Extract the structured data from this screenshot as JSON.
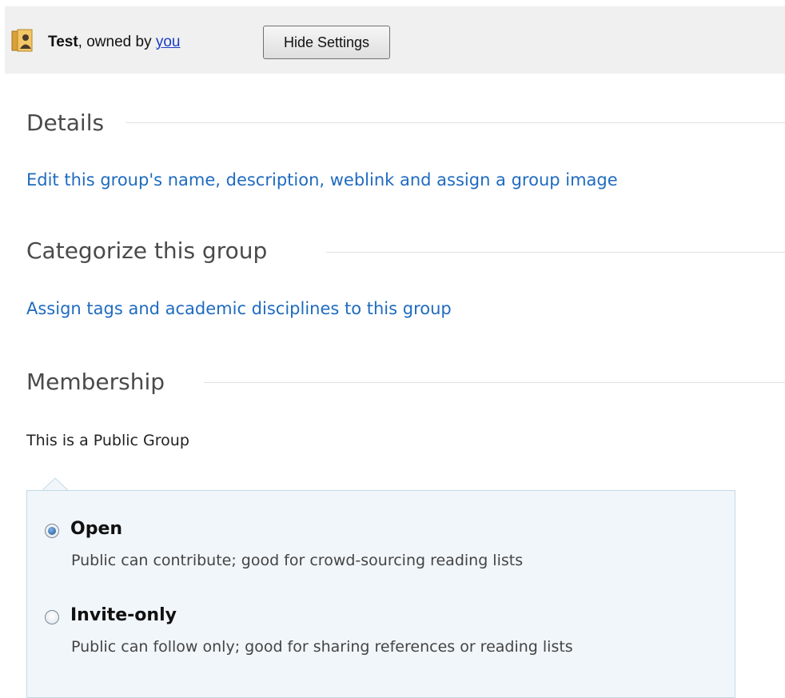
{
  "header": {
    "group_name": "Test",
    "owned_by_text": ", owned by ",
    "owner_link": "you",
    "hide_settings_label": "Hide Settings"
  },
  "sections": {
    "details": {
      "heading": "Details",
      "link": "Edit this group's name, description, weblink and assign a group image"
    },
    "categorize": {
      "heading": "Categorize this group",
      "link": "Assign tags and academic disciplines to this group"
    },
    "membership": {
      "heading": "Membership",
      "status": "This is a Public Group",
      "options": [
        {
          "label": "Open",
          "description": "Public can contribute; good for crowd-sourcing reading lists",
          "selected": true
        },
        {
          "label": "Invite-only",
          "description": "Public can follow only; good for sharing references or reading lists",
          "selected": false
        }
      ]
    }
  },
  "colors": {
    "link": "#1f6bbf",
    "header_bg": "#f0f0f0",
    "options_bg": "#f1f6fa",
    "options_border": "#c4d9e6"
  }
}
